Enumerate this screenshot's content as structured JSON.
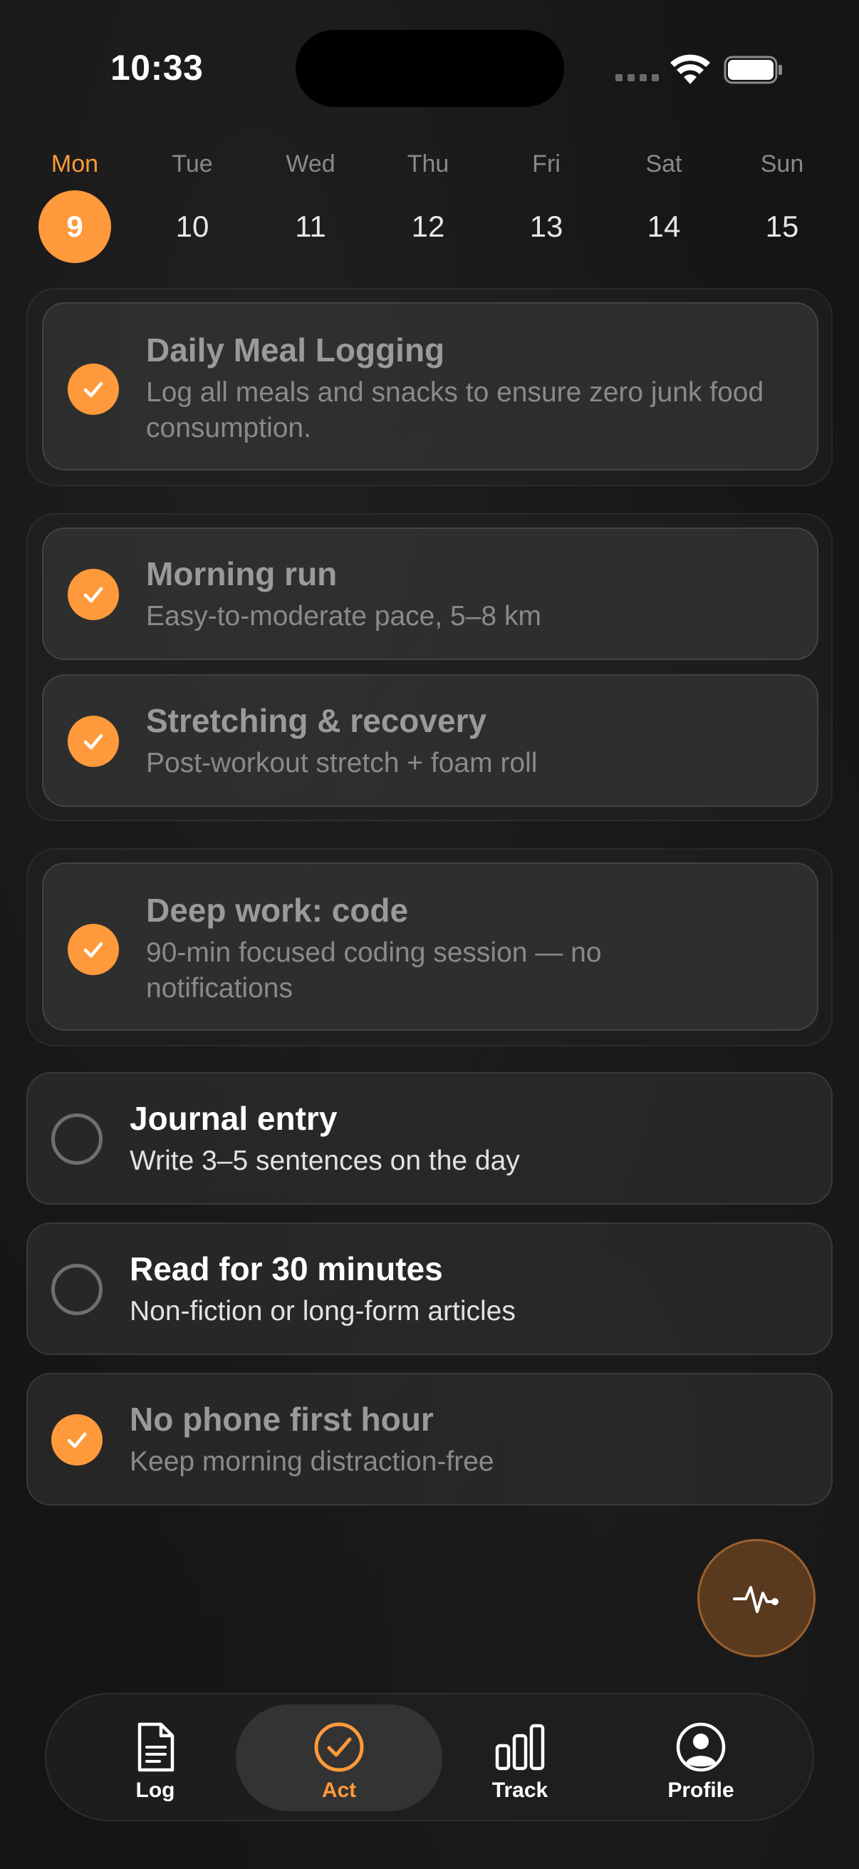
{
  "status_bar": {
    "time": "10:33"
  },
  "week": [
    {
      "name": "Mon",
      "num": "9",
      "active": true
    },
    {
      "name": "Tue",
      "num": "10"
    },
    {
      "name": "Wed",
      "num": "11"
    },
    {
      "name": "Thu",
      "num": "12"
    },
    {
      "name": "Fri",
      "num": "13"
    },
    {
      "name": "Sat",
      "num": "14"
    },
    {
      "name": "Sun",
      "num": "15"
    }
  ],
  "tasks": {
    "meal": {
      "title": "Daily Meal Logging",
      "desc": "Log all meals and snacks to ensure zero junk food consumption.",
      "done": true
    },
    "run": {
      "title": "Morning run",
      "desc": "Easy-to-moderate pace, 5–8 km",
      "done": true
    },
    "stretch": {
      "title": "Stretching & recovery",
      "desc": "Post-workout stretch + foam roll",
      "done": true
    },
    "deepwork": {
      "title": "Deep work: code",
      "desc": "90-min focused coding session — no notifications",
      "done": true
    },
    "journal": {
      "title": "Journal entry",
      "desc": "Write 3–5 sentences on the day",
      "done": false
    },
    "read": {
      "title": "Read for 30 minutes",
      "desc": "Non-fiction or long-form articles",
      "done": false
    },
    "nophone": {
      "title": "No phone first hour",
      "desc": "Keep morning distraction-free",
      "done": true
    }
  },
  "tabbar": {
    "log": "Log",
    "act": "Act",
    "track": "Track",
    "profile": "Profile"
  },
  "colors": {
    "accent": "#ff9a3c",
    "background": "#151515"
  },
  "icons": {
    "fab": "activity-pulse-icon",
    "log": "document-icon",
    "act": "checkmark-circle-icon",
    "track": "bar-chart-icon",
    "profile": "person-circle-icon"
  }
}
